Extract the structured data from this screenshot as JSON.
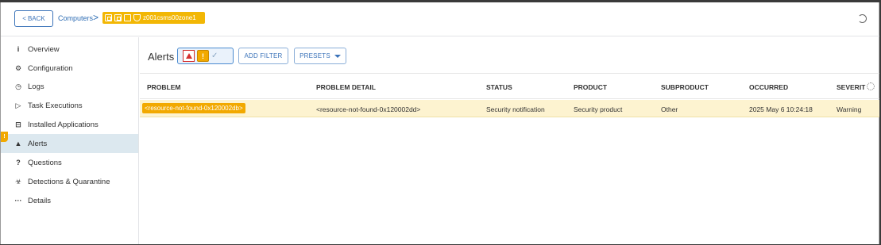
{
  "header": {
    "back_label": "BACK",
    "breadcrumb_link": "Computers",
    "breadcrumb_sep": ">",
    "computer_name": "z001csms00zone1"
  },
  "sidebar": {
    "alert_badge": "!",
    "items": [
      {
        "label": "Overview",
        "icon": "info-icon",
        "glyph": "i"
      },
      {
        "label": "Configuration",
        "icon": "gear-icon",
        "glyph": "⚙"
      },
      {
        "label": "Logs",
        "icon": "clock-icon",
        "glyph": "◷"
      },
      {
        "label": "Task Executions",
        "icon": "play-icon",
        "glyph": "▷"
      },
      {
        "label": "Installed Applications",
        "icon": "apps-icon",
        "glyph": "⊟"
      },
      {
        "label": "Alerts",
        "icon": "warning-icon",
        "glyph": "▲"
      },
      {
        "label": "Questions",
        "icon": "question-icon",
        "glyph": "?"
      },
      {
        "label": "Detections & Quarantine",
        "icon": "biohazard-icon",
        "glyph": "☣"
      },
      {
        "label": "Details",
        "icon": "more-icon",
        "glyph": "···"
      }
    ]
  },
  "main": {
    "title": "Alerts",
    "severity_filter": {
      "warning_glyph": "!",
      "check_glyph": "✓"
    },
    "add_filter_label": "ADD FILTER",
    "presets_label": "PRESETS",
    "columns": [
      "PROBLEM",
      "PROBLEM DETAIL",
      "STATUS",
      "PRODUCT",
      "SUBPRODUCT",
      "OCCURRED",
      "SEVERIT"
    ],
    "rows": [
      {
        "problem": "<resource-not-found-0x120002db>",
        "detail": "<resource-not-found-0x120002dd>",
        "status": "Security notification",
        "product": "Security product",
        "subproduct": "Other",
        "occurred": "2025 May 6 10:24:18",
        "severity": "Warning"
      }
    ]
  },
  "colors": {
    "accent": "#3b73b9",
    "warning": "#f2a900",
    "critical": "#d32f2f",
    "row_highlight": "#fdf3d0",
    "nav_active": "#dce8ef"
  }
}
